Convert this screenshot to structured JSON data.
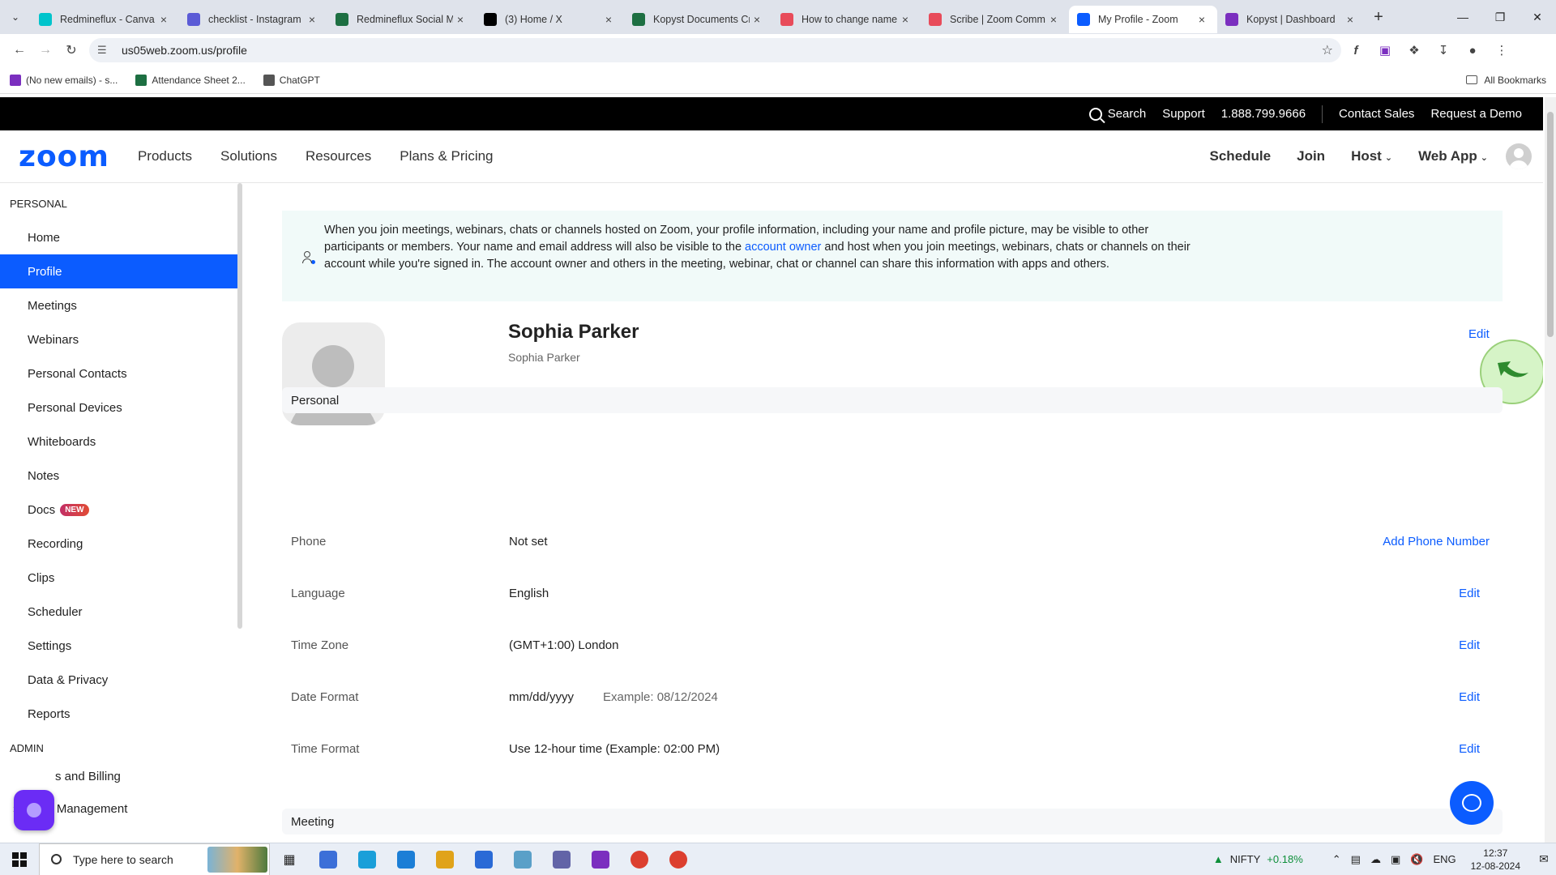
{
  "browser": {
    "tabs": [
      {
        "title": "Redmineflux - Canva",
        "color": "#00c4cc",
        "active": false
      },
      {
        "title": "checklist - Instagram",
        "color": "#5b5bd6",
        "active": false
      },
      {
        "title": "Redmineflux Social M",
        "color": "#1d6f42",
        "active": false
      },
      {
        "title": "(3) Home / X",
        "color": "#000000",
        "active": false
      },
      {
        "title": "Kopyst Documents Cr",
        "color": "#1d6f42",
        "active": false
      },
      {
        "title": "How to change name",
        "color": "#e84b5a",
        "active": false
      },
      {
        "title": "Scribe | Zoom Comm",
        "color": "#e84b5a",
        "active": false
      },
      {
        "title": "My Profile - Zoom",
        "color": "#0b5cff",
        "active": true
      },
      {
        "title": "Kopyst | Dashboard",
        "color": "#7b2fbf",
        "active": false
      }
    ],
    "url": "us05web.zoom.us/profile",
    "bookmarks": [
      {
        "label": "(No new emails) - s...",
        "color": "#7b2fbf"
      },
      {
        "label": "Attendance Sheet 2...",
        "color": "#1d6f42"
      },
      {
        "label": "ChatGPT",
        "color": "#555555"
      }
    ],
    "all_bookmarks": "All Bookmarks"
  },
  "topbar": {
    "search": "Search",
    "support": "Support",
    "phone": "1.888.799.9666",
    "contact_sales": "Contact Sales",
    "request_demo": "Request a Demo"
  },
  "nav": {
    "logo": "zoom",
    "links": [
      "Products",
      "Solutions",
      "Resources",
      "Plans & Pricing"
    ],
    "schedule": "Schedule",
    "join": "Join",
    "host": "Host",
    "web_app": "Web App"
  },
  "sidebar": {
    "personal_label": "PERSONAL",
    "items": [
      "Home",
      "Profile",
      "Meetings",
      "Webinars",
      "Personal Contacts",
      "Personal Devices",
      "Whiteboards",
      "Notes",
      "Docs",
      "Recording",
      "Clips",
      "Scheduler",
      "Settings",
      "Data & Privacy",
      "Reports"
    ],
    "new_badge": "NEW",
    "admin_label": "ADMIN",
    "admin_items": [
      "s and Billing",
      "User Management"
    ]
  },
  "notice": {
    "part1": "When you join meetings, webinars, chats or channels hosted on Zoom, your profile information, including your name and profile picture, may be visible to other participants or members. Your name and email address will also be visible to the ",
    "link": "account owner",
    "part2": " and host when you join meetings, webinars, chats or channels on their account while you're signed in. The account owner and others in the meeting, webinar, chat or channel can share this information with apps and others."
  },
  "profile": {
    "name": "Sophia Parker",
    "display_name": "Sophia Parker",
    "edit": "Edit"
  },
  "personal_section": {
    "title": "Personal",
    "rows": [
      {
        "label": "Phone",
        "value": "Not set",
        "example": "",
        "action": "Add Phone Number"
      },
      {
        "label": "Language",
        "value": "English",
        "example": "",
        "action": "Edit"
      },
      {
        "label": "Time Zone",
        "value": "(GMT+1:00) London",
        "example": "",
        "action": "Edit"
      },
      {
        "label": "Date Format",
        "value": "mm/dd/yyyy",
        "example": "Example: 08/12/2024",
        "action": "Edit"
      },
      {
        "label": "Time Format",
        "value": "Use 12-hour time (Example: 02:00 PM)",
        "example": "",
        "action": "Edit"
      }
    ]
  },
  "meeting_section": {
    "title": "Meeting"
  },
  "taskbar": {
    "search_placeholder": "Type here to search",
    "nifty_label": "NIFTY",
    "nifty_change": "+0.18%",
    "lang": "ENG",
    "time": "12:37",
    "date": "12-08-2024",
    "apps": [
      "#3c6fd8",
      "#1a9fd9",
      "#1c7ed6",
      "#e0a31a",
      "#2a6ad6",
      "#5aa0c8",
      "#6264a7",
      "#7b2fbf",
      "#dc3f2f",
      "#dc3f2f"
    ]
  }
}
